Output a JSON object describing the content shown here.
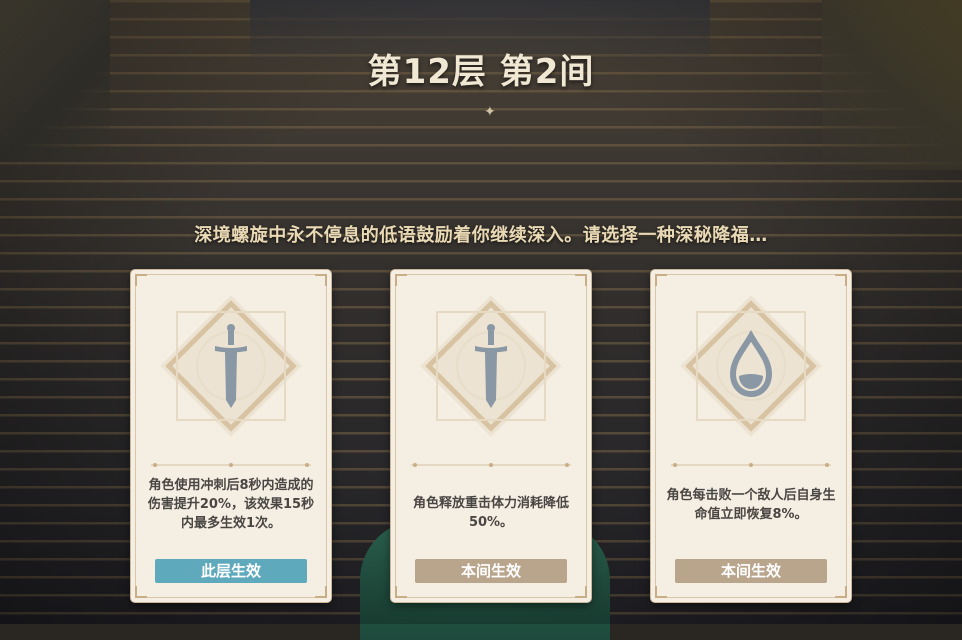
{
  "header": {
    "title": "第12层 第2间",
    "prompt": "深境螺旋中永不停息的低语鼓励着你继续深入。请选择一种深秘降福…"
  },
  "cards": [
    {
      "icon": "sword-icon",
      "description": "角色使用冲刺后8秒内造成的伤害提升20%，该效果15秒内最多生效1次。",
      "button_label": "此层生效",
      "button_color": "#5fa9bd"
    },
    {
      "icon": "sword-icon",
      "description": "角色释放重击体力消耗降低50%。",
      "button_label": "本间生效",
      "button_color": "#b9a48c"
    },
    {
      "icon": "water-drop-icon",
      "description": "角色每击败一个敌人后自身生命值立即恢复8%。",
      "button_label": "本间生效",
      "button_color": "#b9a48c"
    }
  ],
  "colors": {
    "card_bg": "#f5efe3",
    "icon_gray": "#8a97a4",
    "gold": "#c9ad86"
  }
}
